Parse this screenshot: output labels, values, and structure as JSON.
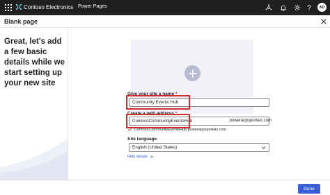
{
  "topbar": {
    "brand_name": "Contoso Electronics",
    "product_name": "Power Pages",
    "avatar_initials": "AD",
    "bg_color": "#1f1f1f"
  },
  "titlebar": {
    "title": "Blank page"
  },
  "left_panel": {
    "headline": "Great, let's add a few basic details while we start setting up your new site"
  },
  "form": {
    "site_name": {
      "label": "Give your site a name",
      "required_marker": "*",
      "value": "Community Events Hub"
    },
    "web_address": {
      "label": "Create a web address",
      "required_marker": "*",
      "value": "ContosoCommunityEventsHub",
      "suffix": ".powerappsportals.com",
      "validation_text": "ContosoCommunityEventsHub.powerappsportals.com"
    },
    "site_language": {
      "label": "Site language",
      "selected": "English (United States)"
    },
    "hide_details_label": "Hide details"
  },
  "footer": {
    "done_label": "Done",
    "accent_color": "#3a5ed6"
  },
  "icons": [
    "waffle-icon",
    "brand-logo-icon",
    "hub-icon",
    "bell-icon",
    "gear-icon",
    "help-icon",
    "close-icon",
    "plus-icon",
    "checkmark-icon",
    "chevron-down-icon",
    "chevron-up-icon"
  ]
}
